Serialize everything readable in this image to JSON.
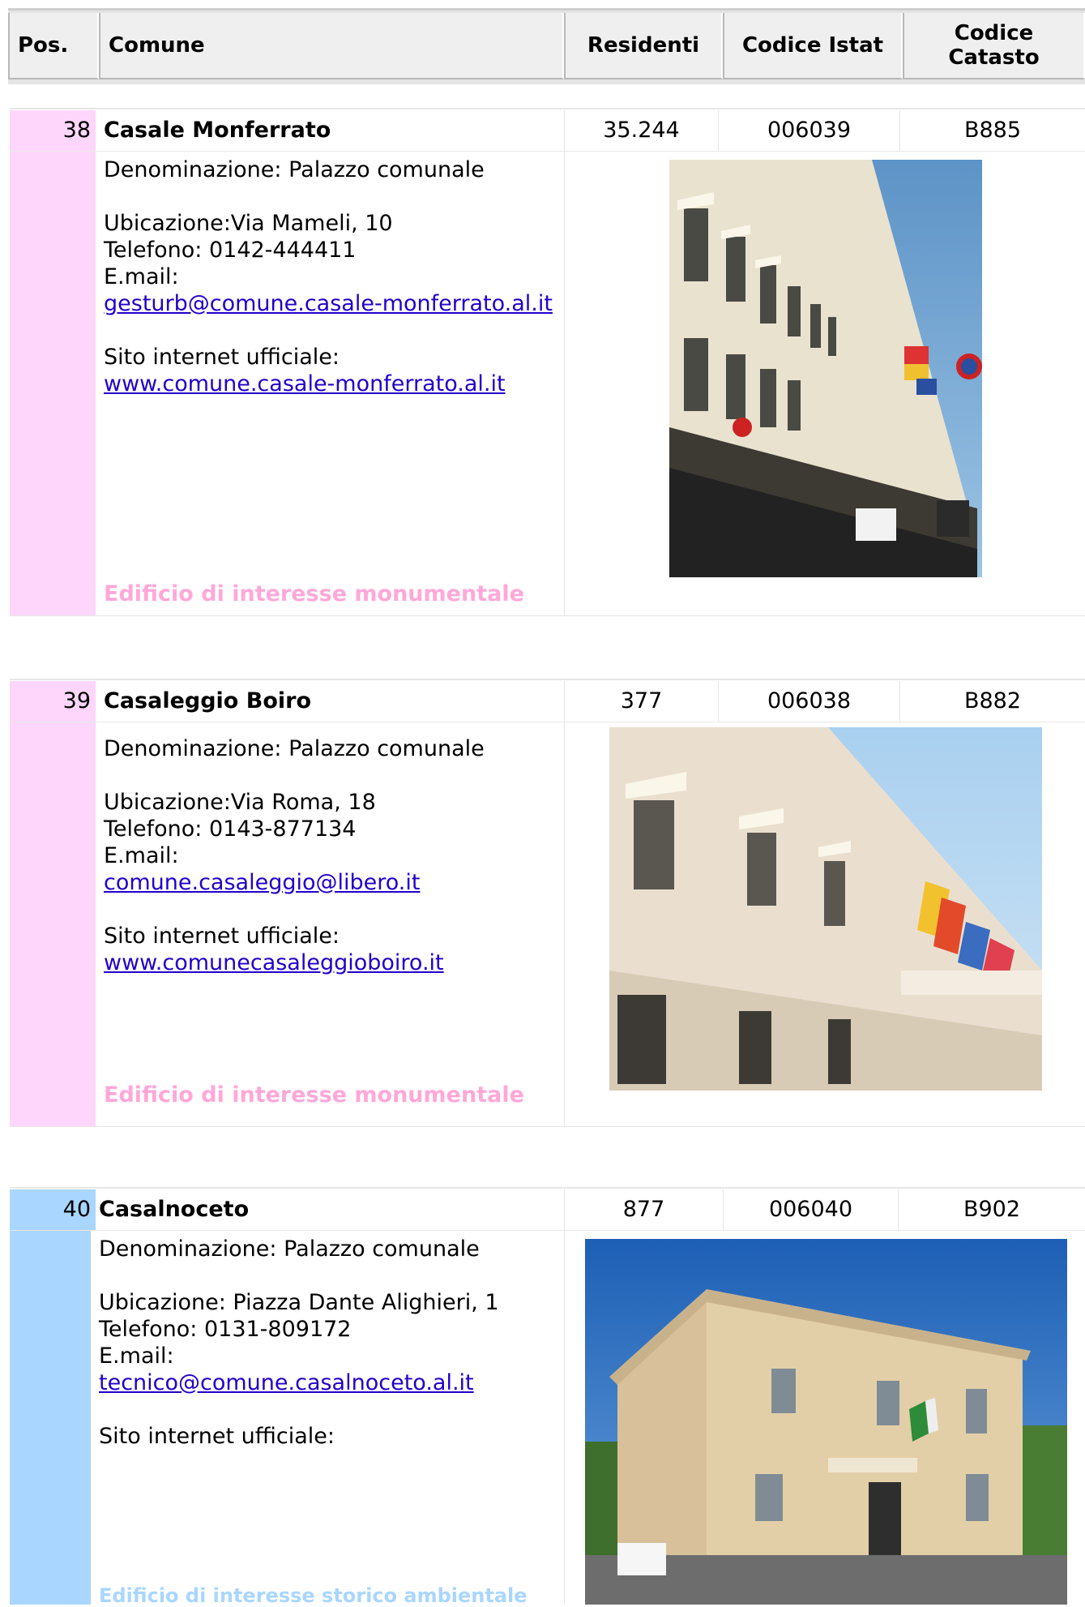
{
  "header": {
    "pos": "Pos.",
    "comune": "Comune",
    "residenti": "Residenti",
    "istat": "Codice Istat",
    "catasto": "Codice Catasto"
  },
  "entries": [
    {
      "pos": "38",
      "name": "Casale Monferrato",
      "residenti": "35.244",
      "istat": "006039",
      "catasto": "B885",
      "denominazione": "Denominazione: Palazzo comunale",
      "ubicazione": "Ubicazione:Via Mameli, 10",
      "telefono": "Telefono: 0142-444411",
      "email_label": "E.mail:",
      "email": "gesturb@comune.casale-monferrato.al.it",
      "sito_label": "Sito internet ufficiale:",
      "sito": "www.comune.casale-monferrato.al.it",
      "tag": "Edificio di interesse monumentale",
      "accent": "#ffd6fb",
      "tag_color": "#ffa8d8"
    },
    {
      "pos": "39",
      "name": "Casaleggio Boiro",
      "residenti": "377",
      "istat": "006038",
      "catasto": "B882",
      "denominazione": "Denominazione: Palazzo comunale",
      "ubicazione": "Ubicazione:Via Roma, 18",
      "telefono": "Telefono: 0143-877134",
      "email_label": "E.mail:",
      "email": "comune.casaleggio@libero.it",
      "sito_label": "Sito internet ufficiale:",
      "sito": "www.comunecasaleggioboiro.it",
      "tag": "Edificio di interesse monumentale",
      "accent": "#ffd6fb",
      "tag_color": "#ffa8d8"
    },
    {
      "pos": "40",
      "name": "Casalnoceto",
      "residenti": "877",
      "istat": "006040",
      "catasto": "B902",
      "denominazione": "Denominazione: Palazzo comunale",
      "ubicazione": "Ubicazione: Piazza Dante Alighieri, 1",
      "telefono": "Telefono: 0131-809172",
      "email_label": "E.mail:",
      "email": "tecnico@comune.casalnoceto.al.it",
      "sito_label": "Sito internet ufficiale:",
      "sito": "",
      "tag": "Edificio di interesse storico ambientale",
      "accent": "#a9d6ff",
      "tag_color": "#a9d6ff"
    }
  ]
}
